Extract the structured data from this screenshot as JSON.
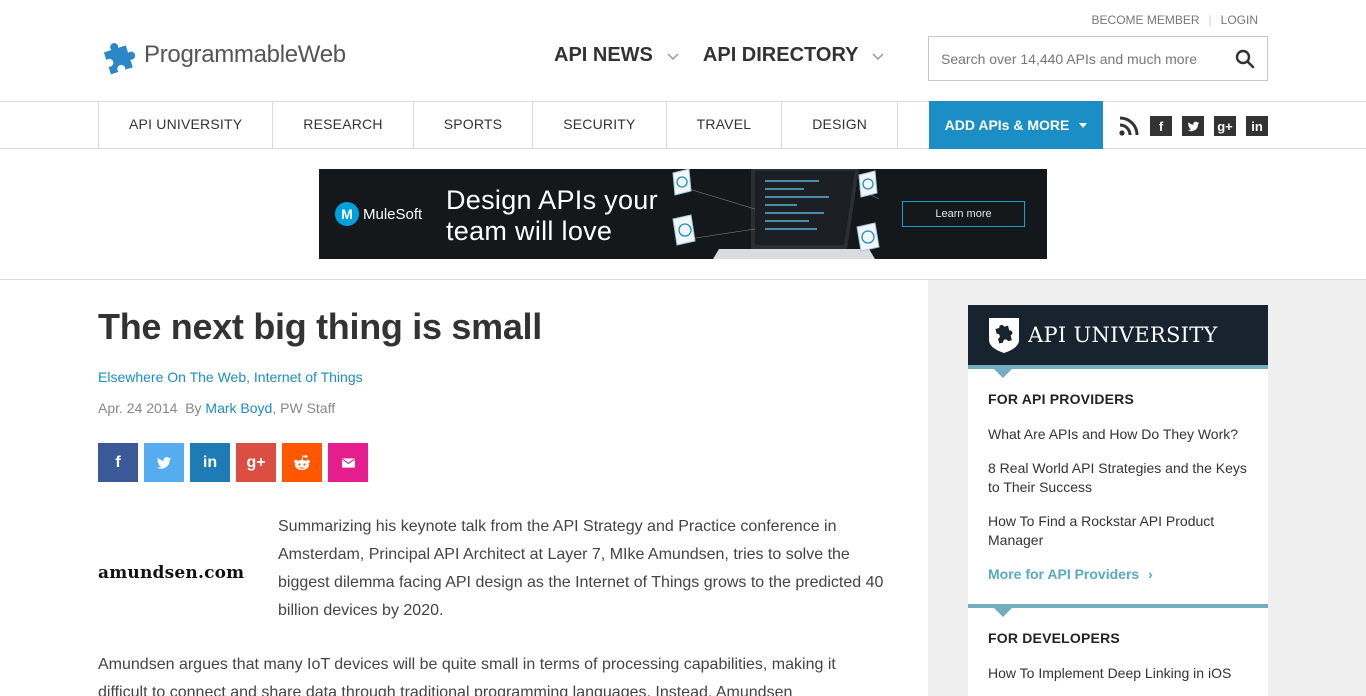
{
  "header": {
    "logo_text": "ProgrammableWeb",
    "become_member": "BECOME MEMBER",
    "separator": "|",
    "login": "LOGIN",
    "nav": [
      "API NEWS",
      "API DIRECTORY"
    ],
    "search_placeholder": "Search over 14,440 APIs and much more"
  },
  "subnav": {
    "categories": [
      "API UNIVERSITY",
      "RESEARCH",
      "SPORTS",
      "SECURITY",
      "TRAVEL",
      "DESIGN"
    ],
    "add_button": "ADD APIs & MORE",
    "social": [
      "rss",
      "facebook",
      "twitter",
      "google-plus",
      "linkedin"
    ]
  },
  "banner": {
    "brand": "MuleSoft",
    "line1": "Design APIs your",
    "line2": "team will love",
    "cta": "Learn more"
  },
  "article": {
    "title": "The next big thing is small",
    "category1": "Elsewhere On The Web",
    "category_sep": ",",
    "category2": "Internet of Things",
    "date": "Apr. 24 2014",
    "by": "By",
    "author": "Mark Boyd",
    "author_suffix": ", PW Staff",
    "share": [
      "f",
      "t",
      "in",
      "g+",
      "reddit",
      "email"
    ],
    "image_text": "amundsen.com",
    "paragraph1": "Summarizing his keynote talk from the API Strategy and Practice conference in Amsterdam, Principal API Architect at Layer 7, MIke Amundsen, tries to solve the biggest dilemma facing API design as the Internet of Things grows to the predicted 40 billion devices by 2020.",
    "paragraph2": "Amundsen argues that many IoT devices will be quite small in terms of processing capabilities, making it difficult to connect and share data through traditional programming languages. Instead, Amundsen"
  },
  "sidebar": {
    "heading": "API UNIVERSITY",
    "providers_title": "FOR API PROVIDERS",
    "providers_links": [
      "What Are APIs and How Do They Work?",
      "8 Real World API Strategies and the Keys to Their Success",
      "How To Find a Rockstar API Product Manager"
    ],
    "providers_more": "More for API Providers",
    "more_arrow": "›",
    "developers_title": "FOR DEVELOPERS",
    "developers_links": [
      "How To Implement Deep Linking in iOS"
    ]
  },
  "colors": {
    "accent": "#1b8ec6",
    "sidebar_rule": "#72aec0",
    "dark": "#17232f"
  }
}
